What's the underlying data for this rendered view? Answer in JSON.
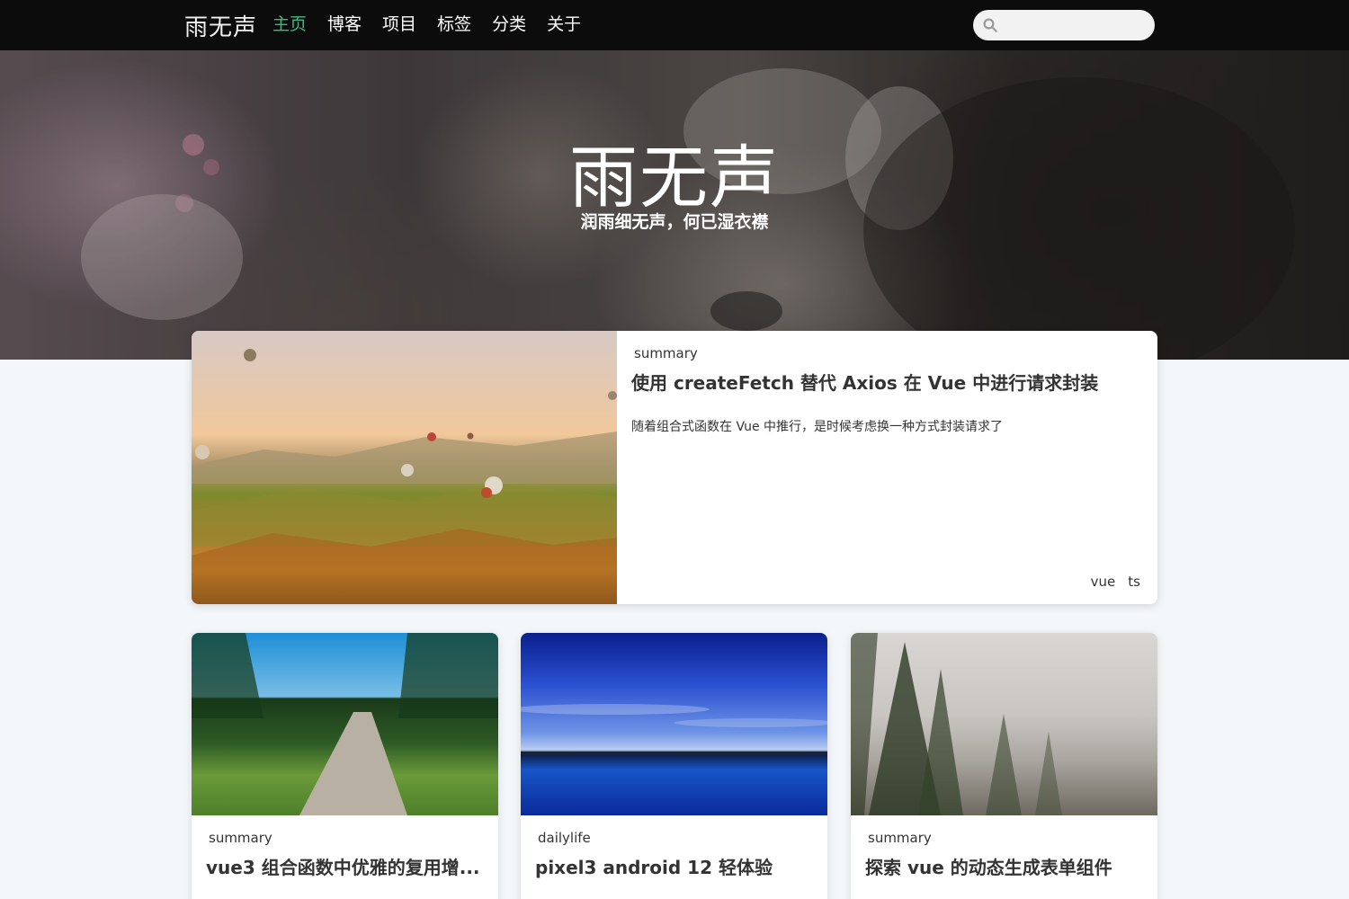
{
  "header": {
    "brand": "雨无声",
    "nav": [
      {
        "label": "主页",
        "active": true
      },
      {
        "label": "博客",
        "active": false
      },
      {
        "label": "项目",
        "active": false
      },
      {
        "label": "标签",
        "active": false
      },
      {
        "label": "分类",
        "active": false
      },
      {
        "label": "关于",
        "active": false
      }
    ],
    "search": {
      "value": "",
      "placeholder": ""
    }
  },
  "hero": {
    "title": "雨无声",
    "subtitle": "润雨细无声，何已湿衣襟"
  },
  "featured": {
    "category": "summary",
    "title": "使用 createFetch 替代 Axios 在 Vue 中进行请求封装",
    "summary": "随着组合式函数在 Vue 中推行，是时候考虑换一种方式封装请求了",
    "tags": [
      "vue",
      "ts"
    ]
  },
  "posts": [
    {
      "category": "summary",
      "title": "vue3 组合函数中优雅的复用增..."
    },
    {
      "category": "dailylife",
      "title": "pixel3 android 12 轻体验"
    },
    {
      "category": "summary",
      "title": "探索 vue 的动态生成表单组件"
    }
  ],
  "colors": {
    "accent": "#42b983",
    "navbar": "#0c0c0c",
    "page_bg": "#f4f7f9"
  }
}
